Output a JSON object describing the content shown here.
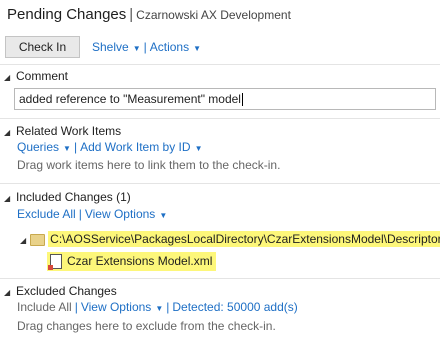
{
  "header": {
    "title": "Pending Changes",
    "separator": "|",
    "workspace": "Czarnowski AX Development"
  },
  "toolbar": {
    "checkin_label": "Check In",
    "shelve_label": "Shelve",
    "actions_label": "Actions"
  },
  "comment": {
    "section_label": "Comment",
    "value": "added reference to \"Measurement\" model"
  },
  "work_items": {
    "section_label": "Related Work Items",
    "queries_label": "Queries",
    "add_by_id_label": "Add Work Item by ID",
    "hint": "Drag work items here to link them to the check-in."
  },
  "included": {
    "section_label": "Included Changes (1)",
    "exclude_all_label": "Exclude All",
    "view_options_label": "View Options",
    "folder_path": "C:\\AOSService\\PackagesLocalDirectory\\CzarExtensionsModel\\Descriptor",
    "file_name": "Czar Extensions Model.xml",
    "highlight_color": "#fdf77a"
  },
  "excluded": {
    "section_label": "Excluded Changes",
    "include_all_label": "Include All",
    "view_options_label": "View Options",
    "detected_label": "Detected: 50000 add(s)",
    "hint": "Drag changes here to exclude from the check-in."
  },
  "colors": {
    "link": "#1e6fc5",
    "background": "#ffffff"
  }
}
